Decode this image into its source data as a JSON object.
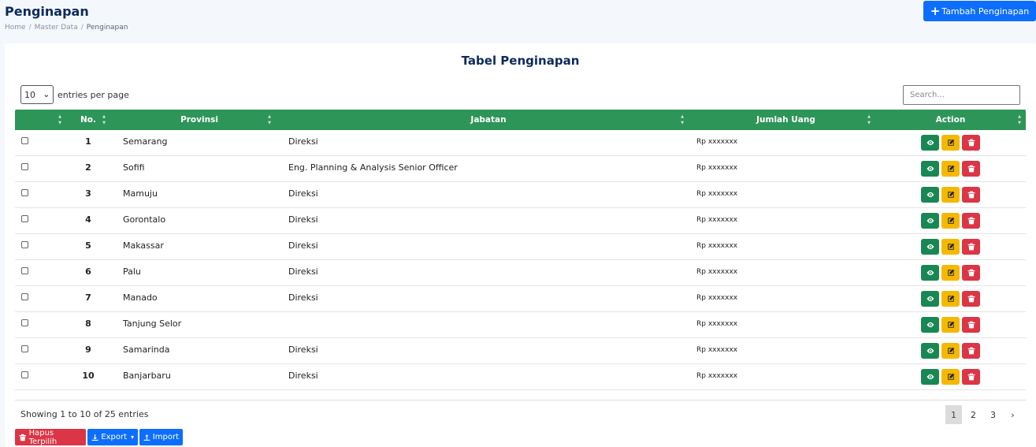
{
  "header": {
    "title": "Penginapan",
    "breadcrumb": [
      "Home",
      "Master Data",
      "Penginapan"
    ],
    "add_button": "Tambah Penginapan"
  },
  "card": {
    "title": "Tabel Penginapan",
    "length_value": "10",
    "length_label": "entries per page",
    "search_placeholder": "Search..."
  },
  "table": {
    "columns": [
      "No.",
      "Provinsi",
      "Jabatan",
      "Jumlah Uang",
      "Action"
    ],
    "rows": [
      {
        "no": "1",
        "provinsi": "Semarang",
        "jabatan": "Direksi",
        "uang": "Rp xxxxxxx"
      },
      {
        "no": "2",
        "provinsi": "Sofifi",
        "jabatan": "Eng. Planning & Analysis Senior Officer",
        "uang": "Rp xxxxxxx"
      },
      {
        "no": "3",
        "provinsi": "Mamuju",
        "jabatan": "Direksi",
        "uang": "Rp xxxxxxx"
      },
      {
        "no": "4",
        "provinsi": "Gorontalo",
        "jabatan": "Direksi",
        "uang": "Rp xxxxxxx"
      },
      {
        "no": "5",
        "provinsi": "Makassar",
        "jabatan": "Direksi",
        "uang": "Rp xxxxxxx"
      },
      {
        "no": "6",
        "provinsi": "Palu",
        "jabatan": "Direksi",
        "uang": "Rp xxxxxxx"
      },
      {
        "no": "7",
        "provinsi": "Manado",
        "jabatan": "Direksi",
        "uang": "Rp xxxxxxx"
      },
      {
        "no": "8",
        "provinsi": "Tanjung Selor",
        "jabatan": "",
        "uang": "Rp xxxxxxx"
      },
      {
        "no": "9",
        "provinsi": "Samarinda",
        "jabatan": "Direksi",
        "uang": "Rp xxxxxxx"
      },
      {
        "no": "10",
        "provinsi": "Banjarbaru",
        "jabatan": "Direksi",
        "uang": "Rp xxxxxxx"
      }
    ]
  },
  "footer": {
    "info": "Showing 1 to 10 of 25 entries",
    "pages": [
      "1",
      "2",
      "3",
      "›"
    ],
    "active_page": "1",
    "buttons": {
      "delete_selected": "Hapus Terpilih",
      "export": "Export",
      "import": "Import"
    }
  },
  "colors": {
    "primary": "#0d6efd",
    "header_green": "#2d9558",
    "view": "#198754",
    "edit": "#f5b800",
    "delete": "#dc3545",
    "title_navy": "#0d2a5c"
  },
  "icons": [
    "plus-icon",
    "eye-icon",
    "edit-icon",
    "trash-icon",
    "download-icon",
    "upload-icon",
    "chevron-down-icon"
  ]
}
